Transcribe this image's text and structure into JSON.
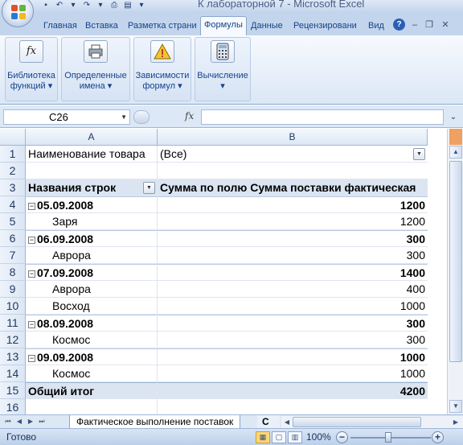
{
  "window": {
    "title": "К лабораторной 7 - Microsoft Excel"
  },
  "ribbon": {
    "tabs": [
      {
        "label": "Главная",
        "active": false
      },
      {
        "label": "Вставка",
        "active": false
      },
      {
        "label": "Разметка страни",
        "active": false
      },
      {
        "label": "Формулы",
        "active": true
      },
      {
        "label": "Данные",
        "active": false
      },
      {
        "label": "Рецензировани",
        "active": false
      },
      {
        "label": "Вид",
        "active": false
      }
    ],
    "groups": [
      {
        "icon": "fx",
        "line1": "Библиотека",
        "line2": "функций ▾"
      },
      {
        "icon": "printer-icon",
        "line1": "Определенные",
        "line2": "имена ▾"
      },
      {
        "icon": "warning-icon",
        "line1": "Зависимости",
        "line2": "формул ▾"
      },
      {
        "icon": "calculator-icon",
        "line1": "Вычисление",
        "line2": "▾"
      }
    ]
  },
  "formula_bar": {
    "name_box": "C26",
    "fx": "fx",
    "value": ""
  },
  "columns": [
    "A",
    "B"
  ],
  "rows": [
    {
      "num": "1",
      "a": "Наименование товара",
      "b": "(Все)",
      "style": "filter"
    },
    {
      "num": "2",
      "a": "",
      "b": "",
      "style": "plain"
    },
    {
      "num": "3",
      "a": "Названия строк",
      "b": "Сумма по полю Сумма поставки фактическая",
      "style": "header"
    },
    {
      "num": "4",
      "a": "05.09.2008",
      "b": "1200",
      "style": "date"
    },
    {
      "num": "5",
      "a": "Заря",
      "b": "1200",
      "style": "item"
    },
    {
      "num": "6",
      "a": "06.09.2008",
      "b": "300",
      "style": "date"
    },
    {
      "num": "7",
      "a": "Аврора",
      "b": "300",
      "style": "item"
    },
    {
      "num": "8",
      "a": "07.09.2008",
      "b": "1400",
      "style": "date"
    },
    {
      "num": "9",
      "a": "Аврора",
      "b": "400",
      "style": "item"
    },
    {
      "num": "10",
      "a": "Восход",
      "b": "1000",
      "style": "item"
    },
    {
      "num": "11",
      "a": "08.09.2008",
      "b": "300",
      "style": "date"
    },
    {
      "num": "12",
      "a": "Космос",
      "b": "300",
      "style": "item"
    },
    {
      "num": "13",
      "a": "09.09.2008",
      "b": "1000",
      "style": "date"
    },
    {
      "num": "14",
      "a": "Космос",
      "b": "1000",
      "style": "item"
    },
    {
      "num": "15",
      "a": "Общий итог",
      "b": "4200",
      "style": "total"
    },
    {
      "num": "16",
      "a": "",
      "b": "",
      "style": "plain"
    }
  ],
  "sheet_tabs": {
    "active": "Фактическое выполнение поставок",
    "next": "С"
  },
  "status_bar": {
    "status": "Готово",
    "zoom": "100%",
    "zoom_level_percent": 100
  },
  "colors": {
    "accent": "#15428b",
    "pivot_header": "#dbe5f1",
    "status_bar": "#bcd0ea"
  }
}
